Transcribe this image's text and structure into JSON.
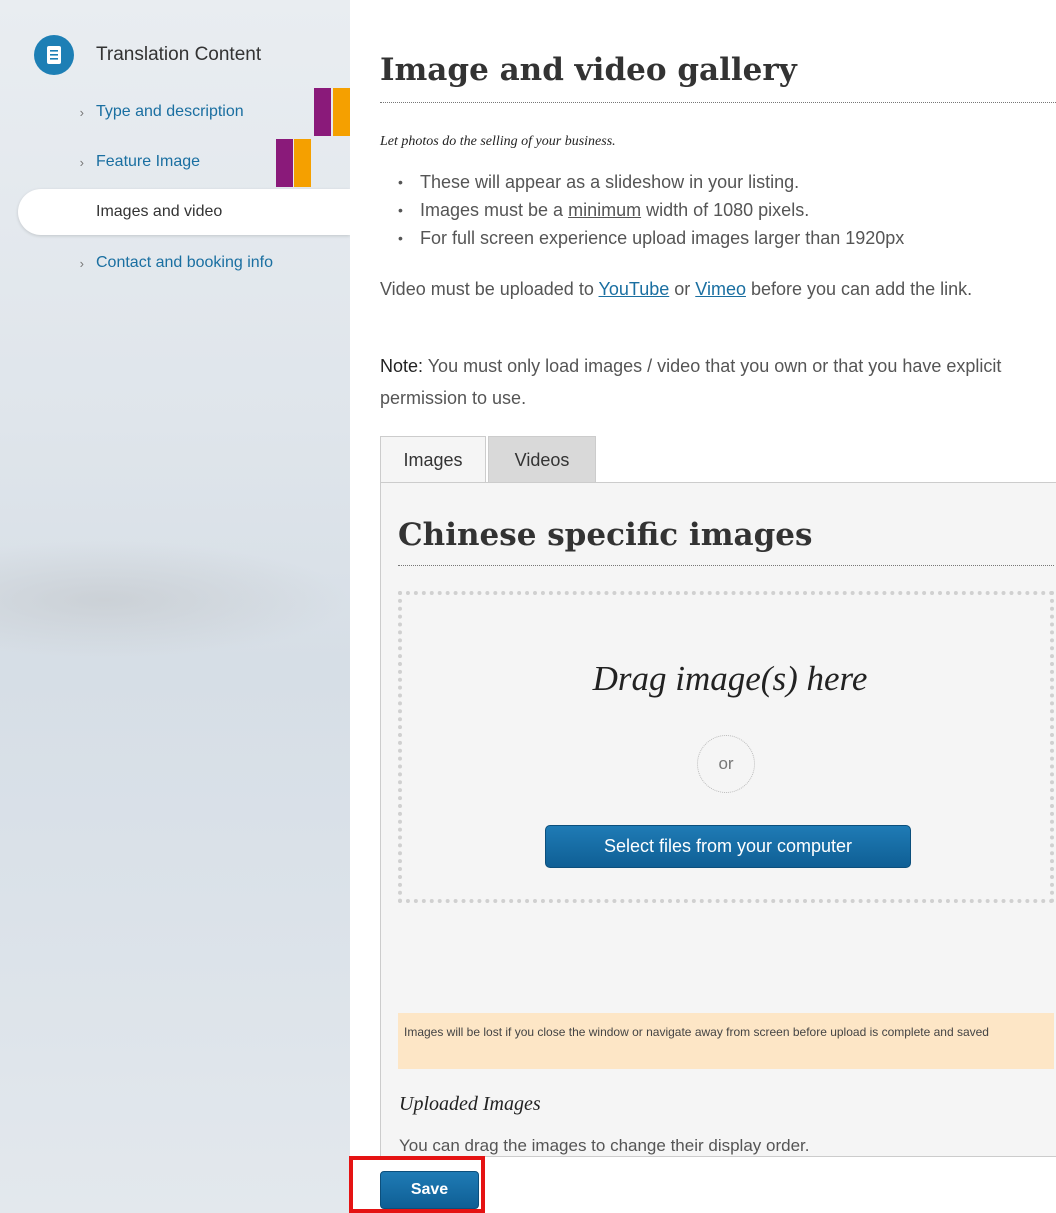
{
  "sidebar": {
    "header": {
      "icon": "document-icon",
      "title": "Translation Content"
    },
    "items": [
      {
        "label": "Type and description",
        "state": "link"
      },
      {
        "label": "Feature Image",
        "state": "link"
      },
      {
        "label": "Images and video",
        "state": "active"
      },
      {
        "label": "Contact and booking info",
        "state": "link"
      }
    ],
    "chevron": "›"
  },
  "main": {
    "title": "Image and video gallery",
    "tagline": "Let photos do the selling of your business.",
    "bullets": {
      "b1": "These will appear as a slideshow in your listing.",
      "b2_pre": "Images must be a ",
      "b2_link": "minimum",
      "b2_post": " width of 1080 pixels.",
      "b3": "For full screen experience upload images larger than 1920px"
    },
    "video_note": {
      "pre": "Video must be uploaded to ",
      "youtube": "YouTube",
      "mid": " or ",
      "vimeo": "Vimeo",
      "post": " before you can add the link."
    },
    "note": {
      "label": "Note:",
      "text": " You must only load images / video that you own or that you have explicit permission to use."
    },
    "tabs": [
      {
        "label": "Images",
        "active": true
      },
      {
        "label": "Videos",
        "active": false
      }
    ],
    "panel": {
      "title": "Chinese specific images",
      "dropzone": {
        "drag_text": "Drag image(s) here",
        "or": "or",
        "select_button": "Select files from your computer"
      },
      "warning": "Images will be lost if you close the window or navigate away from screen before upload is complete and saved",
      "uploaded_title": "Uploaded Images",
      "uploaded_desc": "You can drag the images to change their display order."
    },
    "save_label": "Save"
  },
  "colors": {
    "accent": "#1a6fa1",
    "button": "#1370a8",
    "warning_bg": "#fde6c6",
    "highlight": "#e51313",
    "flag_purple": "#8a1a7a",
    "flag_orange": "#f5a000"
  }
}
